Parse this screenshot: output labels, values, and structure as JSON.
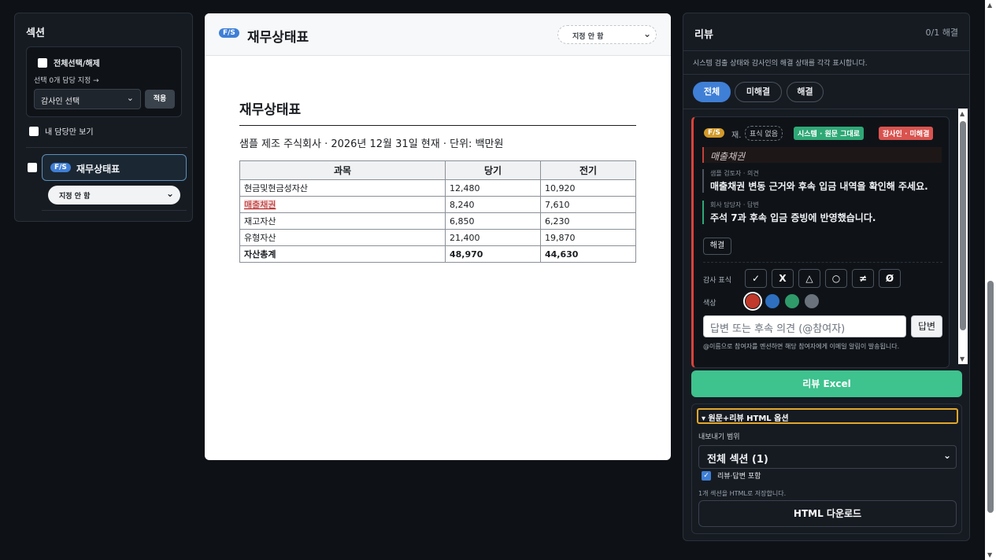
{
  "left": {
    "title": "섹션",
    "select_all_label": "전체선택/해제",
    "selected_assign_label": "선택 0개 담당 지정 →",
    "auditor_select_value": "감사인 선택",
    "apply_label": "적용",
    "mine_only_label": "내 담당만 보기",
    "section_badge": "F/S",
    "section_name": "재무상태표",
    "section_assign_value": "지정 안 함"
  },
  "doc": {
    "badge": "F/S",
    "header_title": "재무상태표",
    "assign_value": "지정 안 함",
    "heading": "재무상태표",
    "subtitle": "샘플 제조 주식회사 · 2026년 12월 31일 현재 · 단위: 백만원",
    "table": {
      "headers": [
        "과목",
        "당기",
        "전기"
      ],
      "rows": [
        [
          "현금및현금성자산",
          "12,480",
          "10,920"
        ],
        [
          "매출채권",
          "8,240",
          "7,610"
        ],
        [
          "재고자산",
          "6,850",
          "6,230"
        ],
        [
          "유형자산",
          "21,400",
          "19,870"
        ],
        [
          "자산총계",
          "48,970",
          "44,630"
        ]
      ]
    }
  },
  "review": {
    "title": "리뷰",
    "count": "0/1 해결",
    "description": "시스템 검출 상태와 감사인의 해결 상태를 각각 표시합니다.",
    "tabs": [
      "전체",
      "미해결",
      "해결"
    ],
    "card": {
      "badge": "F/S",
      "ref": "재.",
      "no_mark": "표식 없음",
      "system_status": "시스템 · 원문 그대로",
      "auditor_status": "감사인 · 미해결",
      "quote": "매출채권",
      "comment1_meta": "샘플 검토자 · 의견",
      "comment1_text": "매출채권 변동 근거와 후속 입금 내역을 확인해 주세요.",
      "comment2_meta": "회사 담당자 · 답변",
      "comment2_text": "주석 7과 후속 입금 증빙에 반영했습니다.",
      "resolve_label": "해결",
      "mark_label": "감사 표식",
      "marks": [
        "✓",
        "X",
        "△",
        "○",
        "≠",
        "Ø"
      ],
      "color_label": "색상",
      "colors": [
        "#c0392b",
        "#2e6fc0",
        "#2f9a6a",
        "#6a727c"
      ],
      "reply_placeholder": "답변 또는 후속 의견 (@참여자)",
      "reply_button": "답변",
      "note": "@이름으로 참여자를 멘션하면 해당 참여자에게 이메일 알림이 발송됩니다."
    },
    "excel_button": "리뷰 Excel",
    "export": {
      "summary": "▾ 원문+리뷰 HTML 옵션",
      "range_label": "내보내기 범위",
      "range_value": "전체 섹션 (1)",
      "include_label": "리뷰·답변 포함",
      "note": "1개 섹션을 HTML로 저장합니다.",
      "download_button": "HTML 다운로드"
    }
  }
}
